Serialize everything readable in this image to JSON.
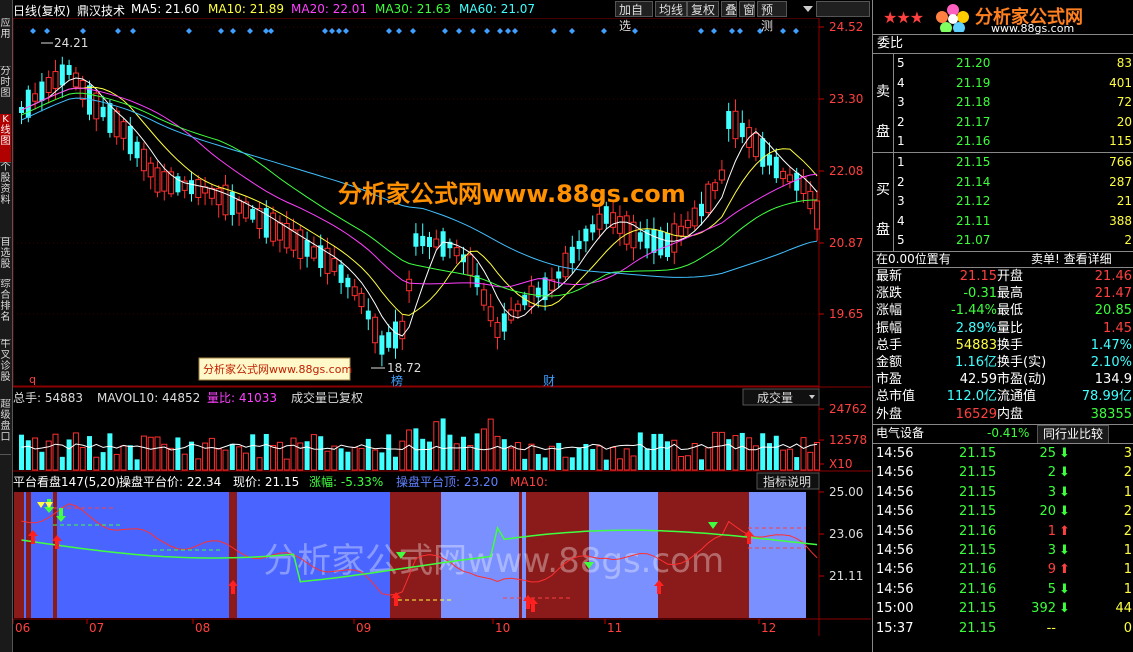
{
  "sidebar": {
    "tabs": [
      {
        "label": "应用",
        "active": false
      },
      {
        "label": "分时图",
        "active": false
      },
      {
        "label": "K线图",
        "active": true
      },
      {
        "label": "个股资料",
        "active": false
      },
      {
        "label": "自选股",
        "active": false
      },
      {
        "label": "综合排名",
        "active": false
      },
      {
        "label": "牛叉诊股",
        "active": false
      },
      {
        "label": "超级盘口",
        "active": false
      }
    ]
  },
  "header": {
    "period": "日线(复权)",
    "stock": "鼎汉技术",
    "ma5": "MA5: 21.60",
    "ma10": "MA10: 21.89",
    "ma20": "MA20: 22.01",
    "ma30": "MA30: 21.63",
    "ma60": "MA60: 21.07",
    "buttons": [
      "加自选",
      "均线",
      "复权",
      "叠",
      "窗",
      "预测"
    ]
  },
  "price_axis": [
    "24.52",
    "23.30",
    "22.08",
    "20.87",
    "19.65"
  ],
  "annotations": {
    "high": "24.21",
    "low": "18.72",
    "q": "q",
    "bang": "榜",
    "cai": "财",
    "watermark_small": "分析家公式网www.88gs.com",
    "watermark_main": "分析家公式网www.88gs.com",
    "watermark_bottom": "分析家公式网www.88gs.com"
  },
  "volume": {
    "total_label": "总手: 54883",
    "mavol": "MAVOL10: 44852",
    "ratio": "量比: 41033",
    "note": "成交量已复权",
    "selector": "成交量",
    "axis": [
      "24762",
      "12578",
      "X10"
    ]
  },
  "indicator": {
    "title": "平台看盘147(5,20)",
    "op_price": "操盘平台价: 22.34",
    "now": "现价: 21.15",
    "change": "涨幅: -5.33%",
    "op_top": "操盘平台顶: 23.20",
    "ma10": "MA10:",
    "explain": "指标说明",
    "axis": [
      "25.00",
      "23.06",
      "21.11"
    ]
  },
  "x_axis": [
    "06",
    "07",
    "08",
    "09",
    "10",
    "11",
    "12"
  ],
  "logo": {
    "title": "分析家公式网",
    "url": "www.88gs.com",
    "stars": "★★★"
  },
  "orderbook": {
    "title": "委比",
    "sell_label": "卖盘",
    "buy_label": "买盘",
    "sell": [
      [
        "5",
        "21.20",
        "83"
      ],
      [
        "4",
        "21.19",
        "401"
      ],
      [
        "3",
        "21.18",
        "72"
      ],
      [
        "2",
        "21.17",
        "20"
      ],
      [
        "1",
        "21.16",
        "115"
      ]
    ],
    "buy": [
      [
        "1",
        "21.15",
        "766"
      ],
      [
        "2",
        "21.14",
        "287"
      ],
      [
        "3",
        "21.12",
        "21"
      ],
      [
        "4",
        "21.11",
        "388"
      ],
      [
        "5",
        "21.07",
        "2"
      ]
    ]
  },
  "position": {
    "left": "在0.00位置有",
    "right": "卖单! 查看详细"
  },
  "stats": [
    [
      "最新",
      "21.15",
      "开盘",
      "21.46"
    ],
    [
      "涨跌",
      "-0.31",
      "最高",
      "21.47"
    ],
    [
      "涨幅",
      "-1.44%",
      "最低",
      "20.85"
    ],
    [
      "振幅",
      "2.89%",
      "量比",
      "1.45"
    ],
    [
      "总手",
      "54883",
      "换手",
      "1.47%"
    ],
    [
      "金额",
      "1.16亿",
      "换手(实)",
      "2.10%"
    ],
    [
      "市盈",
      "42.59",
      "市盈(动)",
      "134.9"
    ],
    [
      "总市值",
      "112.0亿",
      "流通值",
      "78.99亿"
    ],
    [
      "外盘",
      "16529",
      "内盘",
      "38355"
    ]
  ],
  "industry": {
    "name": "电气设备",
    "change": "-0.41%",
    "button": "同行业比较"
  },
  "ticks": [
    [
      "14:56",
      "21.15",
      "25",
      "down",
      "3"
    ],
    [
      "14:56",
      "21.15",
      "2",
      "down",
      "2"
    ],
    [
      "14:56",
      "21.15",
      "3",
      "down",
      "1"
    ],
    [
      "14:56",
      "21.15",
      "20",
      "down",
      "2"
    ],
    [
      "14:56",
      "21.16",
      "1",
      "up",
      "2"
    ],
    [
      "14:56",
      "21.15",
      "3",
      "down",
      "1"
    ],
    [
      "14:56",
      "21.16",
      "9",
      "up",
      "1"
    ],
    [
      "14:56",
      "21.16",
      "5",
      "down",
      "1"
    ],
    [
      "15:00",
      "21.15",
      "392",
      "down",
      "44"
    ],
    [
      "15:37",
      "21.15",
      "--",
      "none",
      "0"
    ]
  ]
}
